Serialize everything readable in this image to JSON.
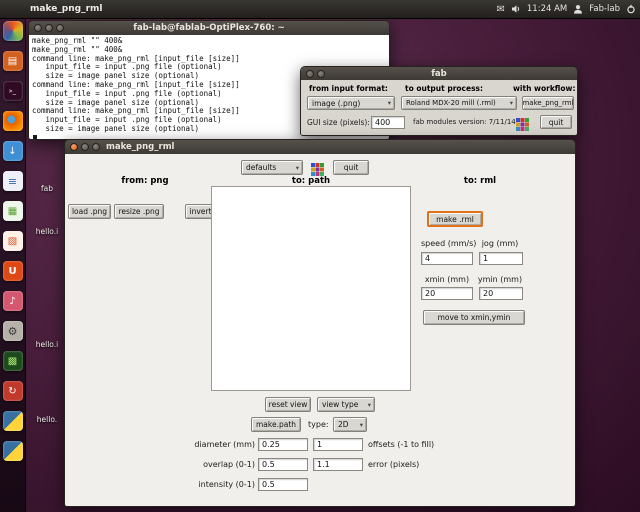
{
  "colors": {
    "focus_highlight": "#e0701a",
    "ubuntu_orange": "#dd4814"
  },
  "top_bar": {
    "app_title": "make_png_rml",
    "time": "11:24 AM",
    "user_label": "Fab-lab"
  },
  "launcher": {
    "items": [
      "dash-home",
      "files",
      "terminal",
      "firefox",
      "software-center",
      "libreoffice-writer",
      "libreoffice-calc",
      "libreoffice-impress",
      "ubuntu-one",
      "rhythmbox",
      "system-settings",
      "fab-modules",
      "software-updater",
      "python",
      "python"
    ]
  },
  "desktop": {
    "icons": [
      "hello.",
      "fab",
      "hello.i",
      "hello.i",
      "hello."
    ]
  },
  "terminal": {
    "title": "fab-lab@fablab-OptiPlex-760: ~",
    "lines": [
      "make_png_rml \"\" 400&",
      "make_png_rml \"\" 400&",
      "command line: make_png_rml [input_file [size]]",
      "   input_file = input .png file (optional)",
      "   size = image panel size (optional)",
      "command line: make_png_rml [input_file [size]]",
      "   input_file = input .png file (optional)",
      "   size = image panel size (optional)",
      "command line: make_png_rml [input_file [size]]",
      "   input_file = input .png file (optional)",
      "   size = image panel size (optional)"
    ]
  },
  "fab_window": {
    "title": "fab",
    "input_format_header": "from input format:",
    "output_process_header": "to output process:",
    "workflow_header": "with workflow:",
    "input_format_value": "image (.png)",
    "output_process_value": "Roland MDX-20 mill (.rml)",
    "workflow_button": "make_png_rml",
    "gui_size_label": "GUI size (pixels):",
    "gui_size_value": "400",
    "version_text": "fab modules version: 7/11/14",
    "quit_button": "quit"
  },
  "main_window": {
    "title": "make_png_rml",
    "defaults_dropdown": "defaults",
    "quit_button": "quit",
    "from_header": "from: png",
    "path_header": "to: path",
    "rml_header": "to: rml",
    "load_png_button": "load .png",
    "resize_png_button": "resize .png",
    "invert_png_button": "invert .png",
    "make_rml_button": "make .rml",
    "speed_label": "speed (mm/s)",
    "jog_label": "jog (mm)",
    "speed_value": "4",
    "jog_value": "1",
    "xmin_label": "xmin (mm)",
    "ymin_label": "ymin (mm)",
    "xmin_value": "20",
    "ymin_value": "20",
    "move_button": "move to xmin,ymin",
    "reset_view_button": "reset view",
    "view_type_dropdown": "view type",
    "make_path_button": "make.path",
    "type_label": "type:",
    "type_dropdown": "2D",
    "diameter_label": "diameter (mm)",
    "diameter_value": "0.25",
    "offsets_value": "1",
    "offsets_label": "offsets (-1 to fill)",
    "overlap_label": "overlap (0-1)",
    "overlap_value": "0.5",
    "error_value": "1.1",
    "error_label": "error (pixels)",
    "intensity_label": "intensity (0-1)",
    "intensity_value": "0.5"
  }
}
